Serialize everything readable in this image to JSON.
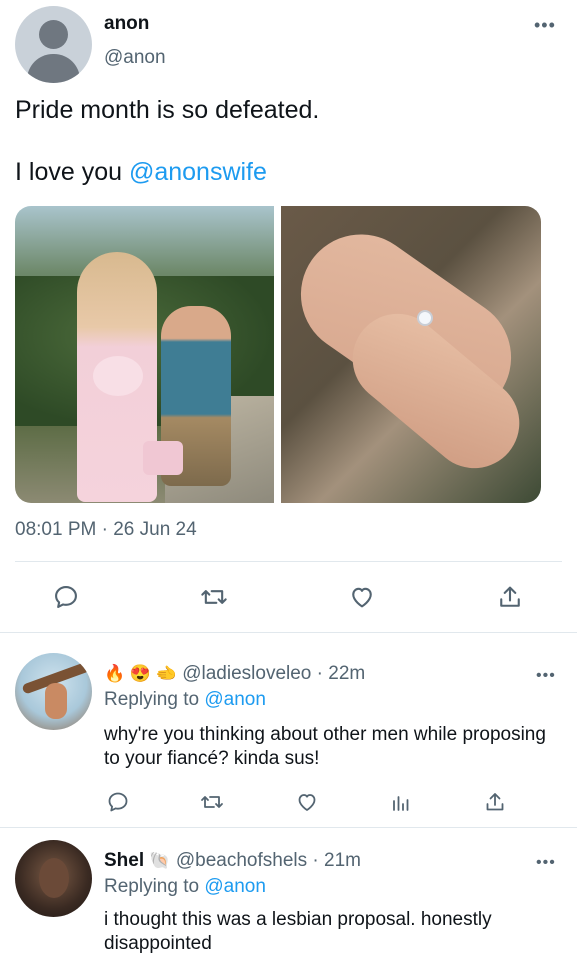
{
  "tweet": {
    "author_name": "anon",
    "author_handle": "@anon",
    "text_line1": "Pride month is so defeated.",
    "text_line2_prefix": "I love you ",
    "text_line2_mention": "@anonswife",
    "timestamp": "08:01 PM · 26 Jun 24",
    "more": "•••",
    "icons": [
      "reply-icon",
      "retweet-icon",
      "like-icon",
      "share-icon"
    ]
  },
  "replies": [
    {
      "emojis": "🔥 😍 🫲",
      "handle": "@ladiesloveleo",
      "time": " · 22m",
      "replying_label": "Replying to ",
      "replying_handle": "@anon",
      "text": "why're you thinking about other men while proposing to your fiancé? kinda sus!",
      "more": "•••",
      "icons": [
        "reply-icon",
        "retweet-icon",
        "like-icon",
        "analytics-icon",
        "share-icon"
      ]
    },
    {
      "name": "Shel",
      "name_emoji": "🐚",
      "handle": "@beachofshels",
      "time": " · 21m",
      "replying_label": "Replying to ",
      "replying_handle": "@anon",
      "text": "i thought this was a lesbian proposal. honestly disappointed",
      "more": "•••"
    }
  ],
  "colors": {
    "accent": "#1d9bf0",
    "text": "#0f1419",
    "secondary": "#536471",
    "divider": "#e1e8ed"
  }
}
